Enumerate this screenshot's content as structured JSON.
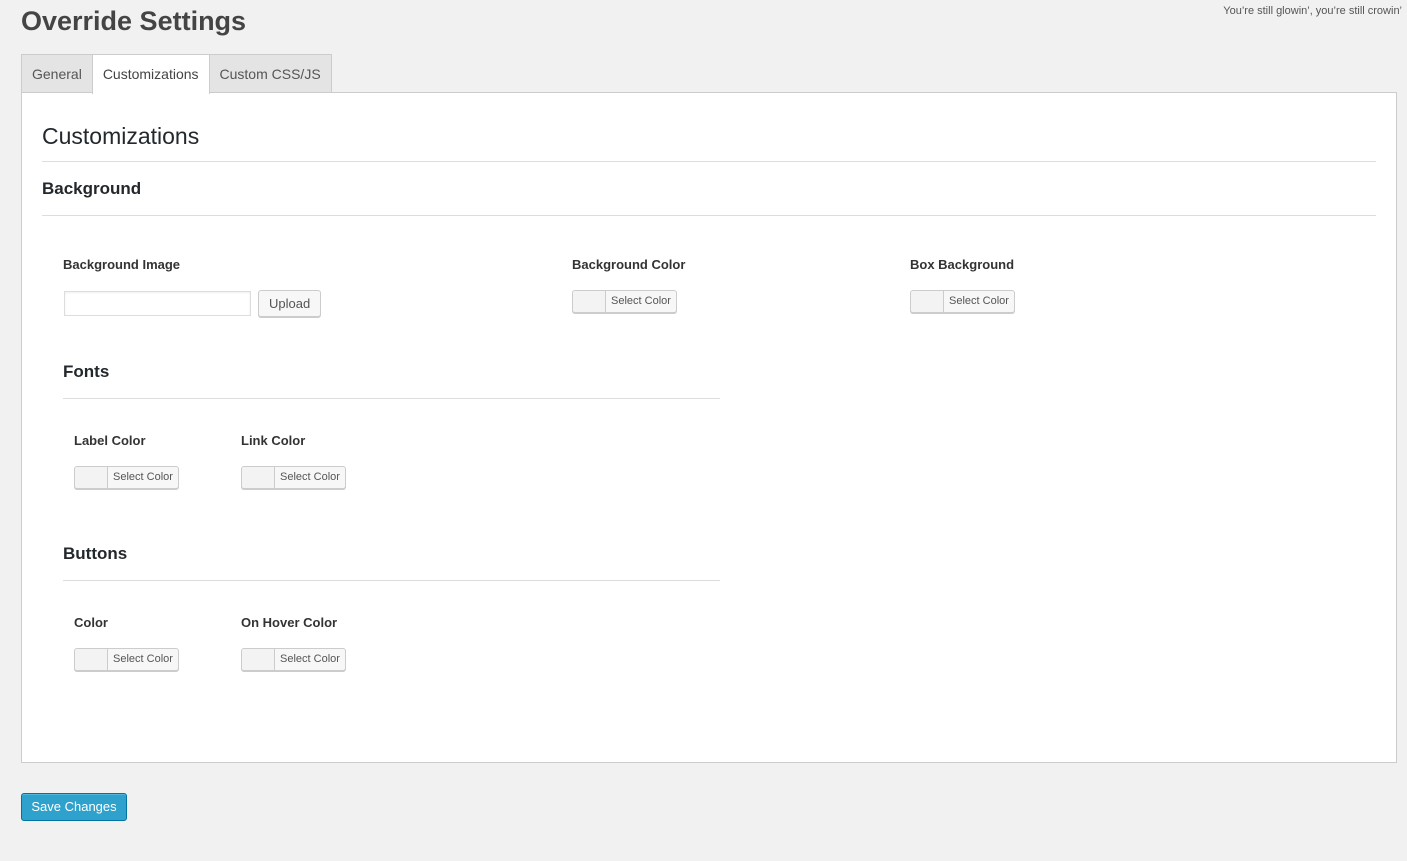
{
  "page": {
    "title": "Override Settings",
    "dolly": "You’re still glowin’, you’re still crowin’"
  },
  "tabs": [
    {
      "label": "General",
      "active": false
    },
    {
      "label": "Customizations",
      "active": true
    },
    {
      "label": "Custom CSS/JS",
      "active": false
    }
  ],
  "panel": {
    "heading": "Customizations",
    "background": {
      "heading": "Background",
      "image_label": "Background Image",
      "image_value": "",
      "upload_label": "Upload",
      "color_label": "Background Color",
      "box_label": "Box Background"
    },
    "fonts": {
      "heading": "Fonts",
      "label_color": "Label Color",
      "link_color": "Link Color"
    },
    "buttons": {
      "heading": "Buttons",
      "color": "Color",
      "hover_color": "On Hover Color"
    },
    "select_color_label": "Select Color"
  },
  "save_label": "Save Changes",
  "colors": {
    "accent": "#2ea2cc",
    "accent_border": "#0074a2"
  }
}
